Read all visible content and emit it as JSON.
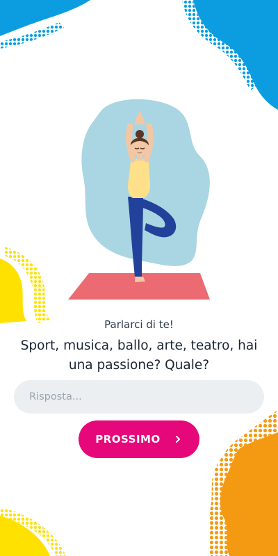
{
  "colors": {
    "accent": "#e6087b",
    "blue": "#0b9de0",
    "yellow": "#ffe100",
    "orange": "#f49a12"
  },
  "illustration": {
    "icon": "yoga-woman-illustration"
  },
  "form": {
    "subtitle": "Parlarci di te!",
    "question": "Sport, musica, ballo, arte, teatro, hai una passione? Quale?",
    "answer_placeholder": "Risposta...",
    "answer_value": ""
  },
  "next_button": {
    "label": "PROSSIMO",
    "icon": "chevron-right-icon"
  }
}
